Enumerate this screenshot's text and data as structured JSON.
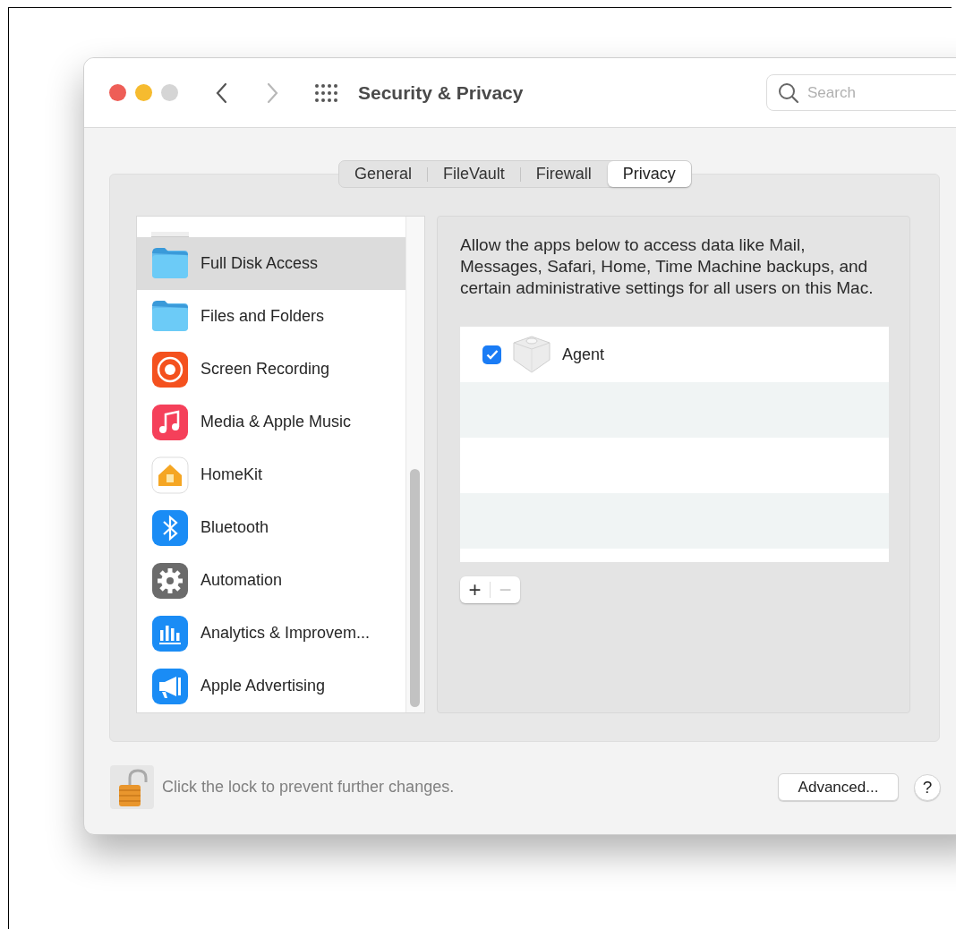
{
  "window": {
    "title": "Security & Privacy",
    "traffic_lights": [
      {
        "color": "#ee5e57"
      },
      {
        "color": "#f6bb2f"
      },
      {
        "color": "#d5d5d5"
      }
    ]
  },
  "search": {
    "placeholder": "Search"
  },
  "tabs": [
    {
      "label": "General",
      "selected": false
    },
    {
      "label": "FileVault",
      "selected": false
    },
    {
      "label": "Firewall",
      "selected": false
    },
    {
      "label": "Privacy",
      "selected": true
    }
  ],
  "sidebar": {
    "items": [
      {
        "label": "Full Disk Access",
        "kind": "folder",
        "selected": true
      },
      {
        "label": "Files and Folders",
        "kind": "folder",
        "selected": false
      },
      {
        "label": "Screen Recording",
        "kind": "record",
        "selected": false
      },
      {
        "label": "Media & Apple Music",
        "kind": "music",
        "selected": false
      },
      {
        "label": "HomeKit",
        "kind": "home",
        "selected": false
      },
      {
        "label": "Bluetooth",
        "kind": "bluetooth",
        "selected": false
      },
      {
        "label": "Automation",
        "kind": "gear",
        "selected": false
      },
      {
        "label": "Analytics & Improvem...",
        "kind": "chart",
        "selected": false
      },
      {
        "label": "Apple Advertising",
        "kind": "megaphone",
        "selected": false
      }
    ]
  },
  "description": "Allow the apps below to access data like Mail, Messages, Safari, Home, Time Machine backups, and certain administrative settings for all users on this Mac.",
  "apps": [
    {
      "name": "Agent",
      "checked": true
    }
  ],
  "list_buttons": [
    "+",
    "−"
  ],
  "lock": {
    "locked": false,
    "message": "Click the lock to prevent further changes."
  },
  "buttons": [
    "Advanced...",
    "?"
  ]
}
